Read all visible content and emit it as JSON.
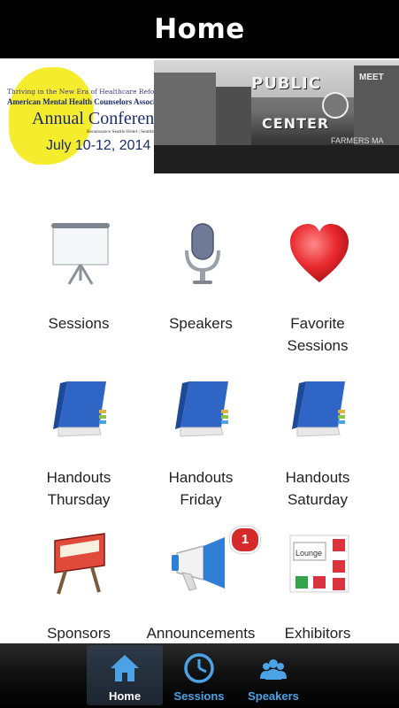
{
  "header": {
    "title": "Home"
  },
  "banner": {
    "tagline": "Thriving in the New Era of Healthcare Reform",
    "org": "American Mental Health Counselors Association",
    "event": "Annual Conference",
    "venue": "Renaissance Seattle Hotel | Seattle",
    "dates": "July 10-12, 2014",
    "photo_sign_top": "PUBLIC",
    "photo_sign_bottom": "CENTER",
    "photo_meet": "MEET",
    "photo_fl": "FARMERS MA"
  },
  "tiles": [
    {
      "icon": "projector-screen-icon",
      "label_line1": "Sessions",
      "label_line2": ""
    },
    {
      "icon": "microphone-icon",
      "label_line1": "Speakers",
      "label_line2": ""
    },
    {
      "icon": "heart-icon",
      "label_line1": "Favorite",
      "label_line2": "Sessions"
    },
    {
      "icon": "book-icon",
      "label_line1": "Handouts",
      "label_line2": "Thursday"
    },
    {
      "icon": "book-icon",
      "label_line1": "Handouts",
      "label_line2": "Friday"
    },
    {
      "icon": "book-icon",
      "label_line1": "Handouts",
      "label_line2": "Saturday"
    },
    {
      "icon": "billboard-icon",
      "label_line1": "Sponsors",
      "label_line2": ""
    },
    {
      "icon": "megaphone-icon",
      "label_line1": "Announcements",
      "label_line2": "",
      "badge": "1"
    },
    {
      "icon": "floor-plan-icon",
      "label_line1": "Exhibitors",
      "label_line2": "",
      "icon_text": "Lounge"
    }
  ],
  "tabbar": {
    "items": [
      {
        "label": "Home",
        "icon": "house-icon",
        "active": true
      },
      {
        "label": "Sessions",
        "icon": "clock-icon",
        "active": false
      },
      {
        "label": "Speakers",
        "icon": "people-icon",
        "active": false
      }
    ]
  },
  "colors": {
    "header_bg": "#000000",
    "tab_active_label": "#ffffff",
    "tab_inactive_label": "#4ba3e6",
    "badge_red": "#d42a2a"
  }
}
